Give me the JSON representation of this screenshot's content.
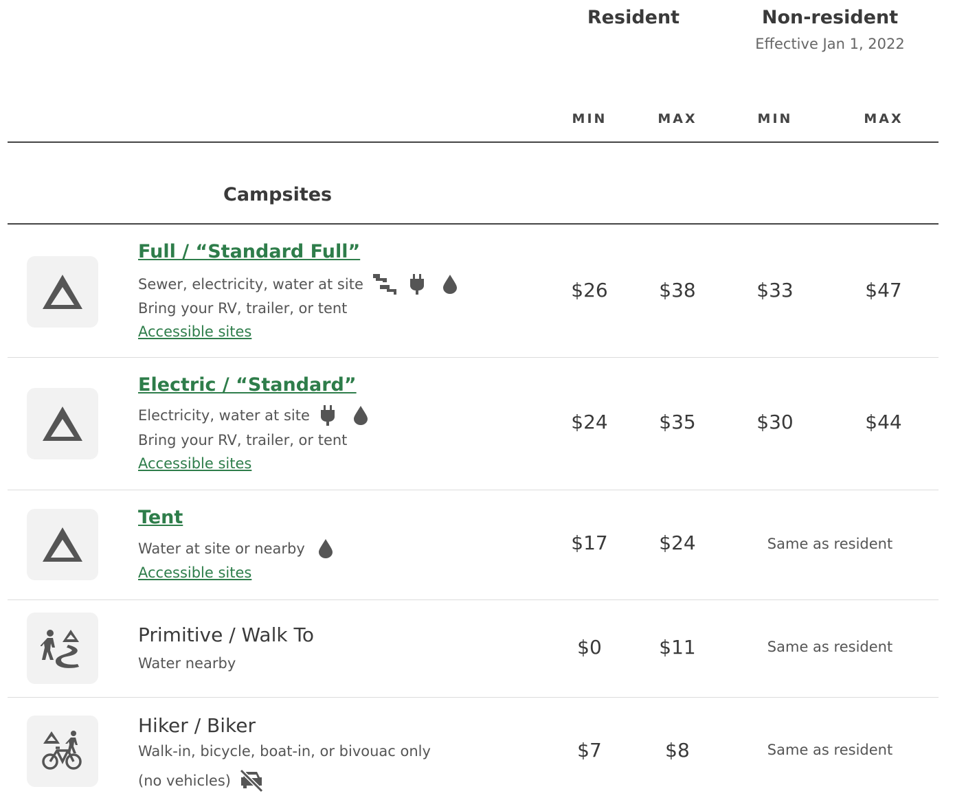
{
  "header": {
    "resident": "Resident",
    "non_resident": "Non-resident",
    "effective": "Effective Jan 1, 2022",
    "min": "MIN",
    "max": "MAX"
  },
  "section": {
    "title": "Campsites"
  },
  "rows": [
    {
      "title": "Full / “Standard Full”",
      "line1": "Sewer, electricity, water at site",
      "line2": "Bring your RV, trailer, or tent",
      "link": "Accessible sites",
      "res_min": "$26",
      "res_max": "$38",
      "non_min": "$33",
      "non_max": "$47",
      "icons": [
        "sewer-icon",
        "electric-plug-icon",
        "water-drop-icon"
      ]
    },
    {
      "title": "Electric / “Standard”",
      "line1": "Electricity, water at site",
      "line2": "Bring your RV, trailer, or tent",
      "link": "Accessible sites",
      "res_min": "$24",
      "res_max": "$35",
      "non_min": "$30",
      "non_max": "$44",
      "icons": [
        "electric-plug-icon",
        "water-drop-icon"
      ]
    },
    {
      "title": "Tent",
      "line1": "Water at site or nearby",
      "link": "Accessible sites",
      "res_min": "$17",
      "res_max": "$24",
      "same": "Same as resident",
      "icons": [
        "water-drop-icon"
      ]
    },
    {
      "title": "Primitive / Walk To",
      "line1": "Water nearby",
      "res_min": "$0",
      "res_max": "$11",
      "same": "Same as resident",
      "icons": [
        "hiker-trail-icon"
      ]
    },
    {
      "title": "Hiker / Biker",
      "line1": "Walk-in, bicycle, boat-in, or bivouac only",
      "line2": "(no vehicles)",
      "res_min": "$7",
      "res_max": "$8",
      "same": "Same as resident",
      "icons": [
        "hiker-biker-icon",
        "no-vehicle-icon"
      ]
    }
  ],
  "colors": {
    "link": "#2e7d4a",
    "text": "#3a3a3a",
    "icon": "#555555",
    "icon_bg": "#f2f2f2"
  }
}
